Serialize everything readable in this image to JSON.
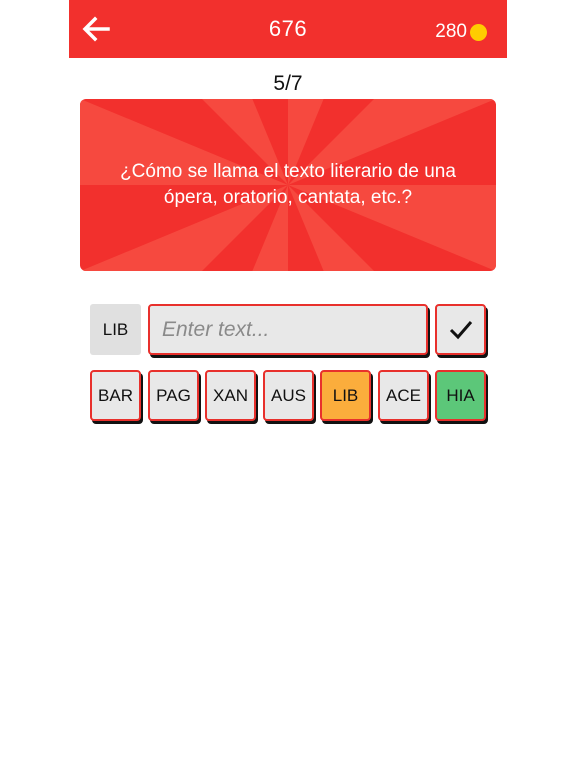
{
  "header": {
    "level": "676",
    "coins": "280",
    "back_icon": "arrow-left-icon",
    "coin_icon": "coin-icon"
  },
  "progress": "5/7",
  "question": {
    "text": "¿Cómo se llama el texto literario de una ópera, oratorio, cantata, etc.?"
  },
  "answer": {
    "prefix": "LIB",
    "input_value": "",
    "input_placeholder": "Enter text...",
    "submit_icon": "checkmark-icon"
  },
  "options": [
    {
      "label": "BAR",
      "state": "normal"
    },
    {
      "label": "PAG",
      "state": "normal"
    },
    {
      "label": "XAN",
      "state": "normal"
    },
    {
      "label": "AUS",
      "state": "normal"
    },
    {
      "label": "LIB",
      "state": "selected"
    },
    {
      "label": "ACE",
      "state": "normal"
    },
    {
      "label": "HIA",
      "state": "hint"
    }
  ],
  "colors": {
    "primary_red": "#f2302d",
    "ray_light": "#f6493f",
    "selected": "#fbad3c",
    "hint": "#5cc779",
    "button_bg": "#e8e8e8",
    "coin": "#ffcc00"
  }
}
